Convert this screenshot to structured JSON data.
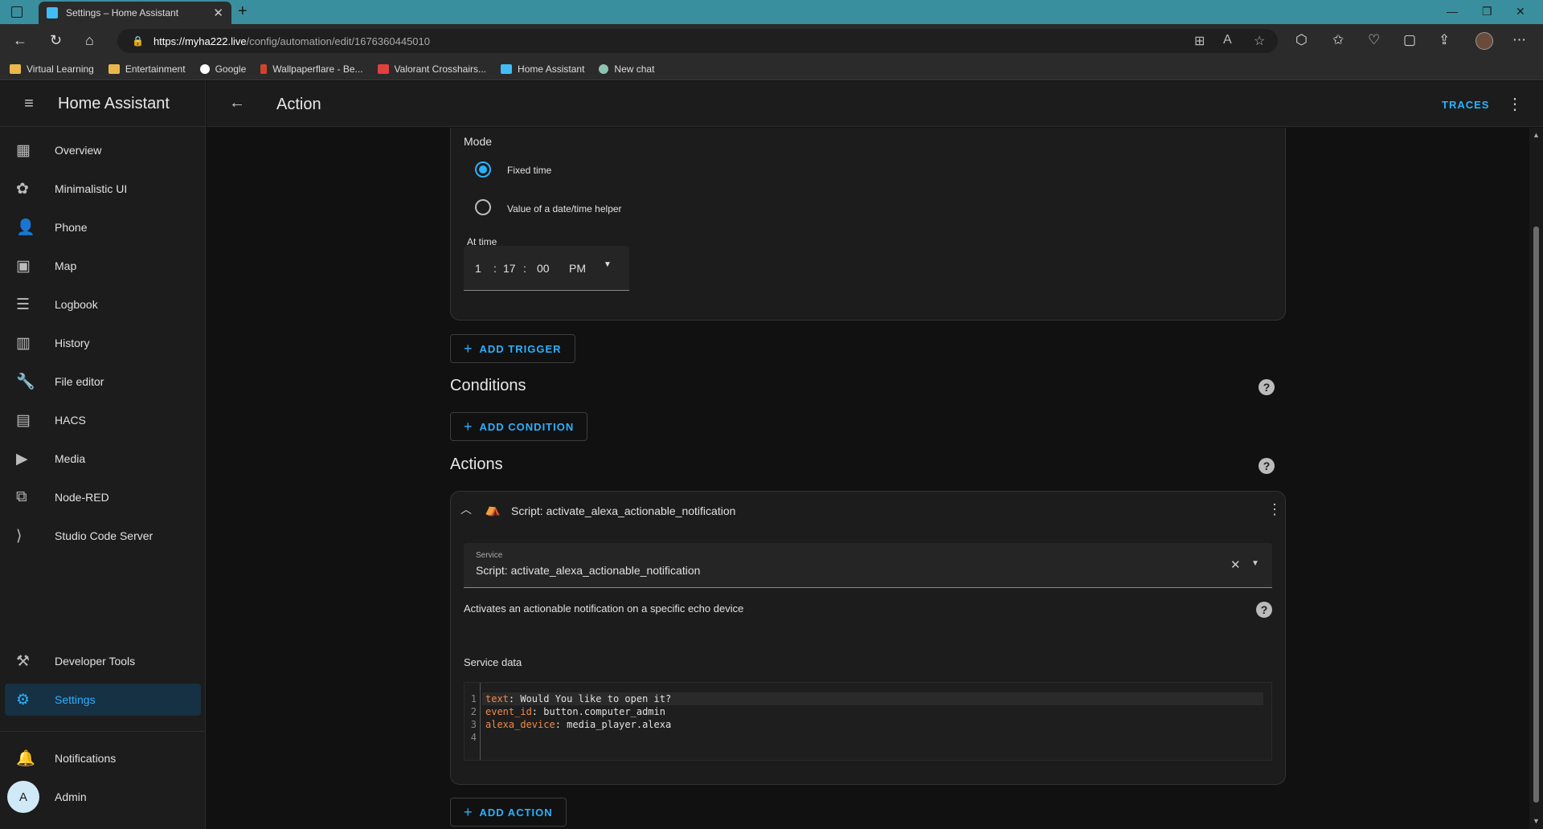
{
  "browser": {
    "tab_title": "Settings – Home Assistant",
    "url_host": "https://myha222.live",
    "url_path": "/config/automation/edit/1676360445010",
    "bookmarks": [
      {
        "label": "Virtual Learning",
        "color": "#e8b84a"
      },
      {
        "label": "Entertainment",
        "color": "#e8b84a"
      },
      {
        "label": "Google",
        "color": "#ffffff"
      },
      {
        "label": "Wallpaperflare - Be...",
        "color": "#d0442b"
      },
      {
        "label": "Valorant Crosshairs...",
        "color": "#e04040"
      },
      {
        "label": "Home Assistant",
        "color": "#41bdf5"
      },
      {
        "label": "New chat",
        "color": "#8cc4b0"
      }
    ]
  },
  "sidebar": {
    "title": "Home Assistant",
    "items": [
      {
        "label": "Overview",
        "icon": "▦"
      },
      {
        "label": "Minimalistic UI",
        "icon": "✿"
      },
      {
        "label": "Phone",
        "icon": "👤"
      },
      {
        "label": "Map",
        "icon": "▣"
      },
      {
        "label": "Logbook",
        "icon": "☰"
      },
      {
        "label": "History",
        "icon": "▥"
      },
      {
        "label": "File editor",
        "icon": "🔧"
      },
      {
        "label": "HACS",
        "icon": "▤"
      },
      {
        "label": "Media",
        "icon": "▶"
      },
      {
        "label": "Node-RED",
        "icon": "⧉"
      },
      {
        "label": "Studio Code Server",
        "icon": "⟩"
      }
    ],
    "developer_tools": "Developer Tools",
    "settings": "Settings",
    "notifications": "Notifications",
    "user_initial": "A",
    "user_name": "Admin"
  },
  "header": {
    "title": "Action",
    "traces": "TRACES"
  },
  "trigger": {
    "mode_label": "Mode",
    "options": [
      "Fixed time",
      "Value of a date/time helper"
    ],
    "selected": "Fixed time",
    "at_time_label": "At time",
    "hour": "1",
    "minute": "17",
    "second": "00",
    "ampm": "PM",
    "add_trigger": "ADD TRIGGER"
  },
  "conditions": {
    "title": "Conditions",
    "add_condition": "ADD CONDITION"
  },
  "actions": {
    "title": "Actions",
    "item_title": "Script: activate_alexa_actionable_notification",
    "service_label": "Service",
    "service_value": "Script: activate_alexa_actionable_notification",
    "description": "Activates an actionable notification on a specific echo device",
    "service_data_label": "Service data",
    "code": [
      {
        "n": "1",
        "key": "text",
        "val": ": Would You like to open it?"
      },
      {
        "n": "2",
        "key": "event_id",
        "val": ": button.computer_admin"
      },
      {
        "n": "3",
        "key": "alexa_device",
        "val": ": media_player.alexa"
      },
      {
        "n": "4",
        "key": "",
        "val": ""
      }
    ],
    "add_action": "ADD ACTION"
  },
  "colors": {
    "accent": "#2bb1ff",
    "yaml_key": "#f08a4b"
  }
}
